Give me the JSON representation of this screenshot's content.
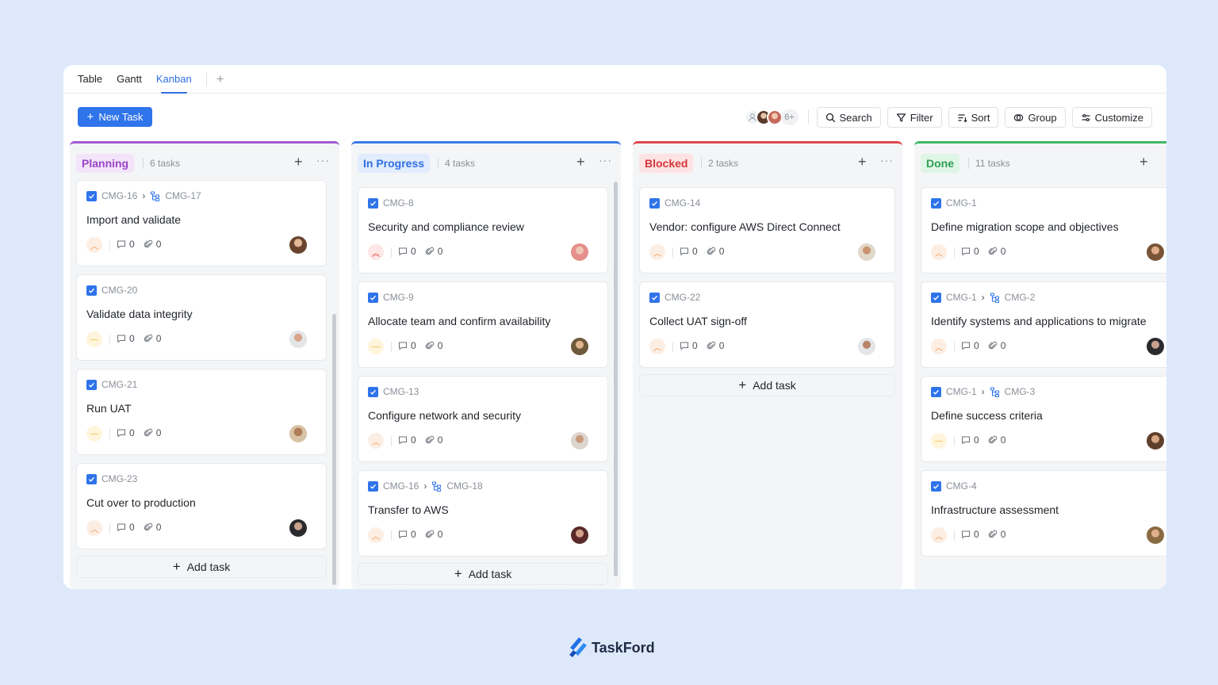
{
  "tabs": [
    {
      "label": "Table",
      "active": false
    },
    {
      "label": "Gantt",
      "active": false
    },
    {
      "label": "Kanban",
      "active": true
    }
  ],
  "toolbar": {
    "new_task_label": "New Task",
    "avatars_more": "6+",
    "search_label": "Search",
    "filter_label": "Filter",
    "sort_label": "Sort",
    "group_label": "Group",
    "customize_label": "Customize"
  },
  "colors": {
    "accent": "#2f74ea",
    "planning": "#a35bd0",
    "in_progress": "#3a7be6",
    "blocked": "#e0484d",
    "done": "#3fb964"
  },
  "columns": [
    {
      "title": "Planning",
      "count": "6 tasks",
      "add_label": "Add task",
      "cards": [
        {
          "id": "CMG-16",
          "sub_id": "CMG-17",
          "title": "Import and validate",
          "priority": "high",
          "comments": "0",
          "attachments": "0",
          "assignee": "avatar"
        },
        {
          "id": "CMG-20",
          "title": "Validate data integrity",
          "priority": "medium",
          "comments": "0",
          "attachments": "0",
          "assignee": "avatar"
        },
        {
          "id": "CMG-21",
          "title": "Run UAT",
          "priority": "medium",
          "comments": "0",
          "attachments": "0",
          "assignee": "avatar"
        },
        {
          "id": "CMG-23",
          "title": "Cut over to production",
          "priority": "high",
          "comments": "0",
          "attachments": "0",
          "assignee": "avatar"
        }
      ]
    },
    {
      "title": "In Progress",
      "count": "4 tasks",
      "add_label": "Add task",
      "cards": [
        {
          "id": "CMG-8",
          "title": "Security and compliance review",
          "priority": "urgent",
          "comments": "0",
          "attachments": "0",
          "assignee": "avatar"
        },
        {
          "id": "CMG-9",
          "title": "Allocate team and confirm availability",
          "priority": "medium",
          "comments": "0",
          "attachments": "0",
          "assignee": "avatar"
        },
        {
          "id": "CMG-13",
          "title": "Configure network and security",
          "priority": "high",
          "comments": "0",
          "attachments": "0",
          "assignee": "avatar"
        },
        {
          "id": "CMG-16",
          "sub_id": "CMG-18",
          "title": "Transfer to AWS",
          "priority": "high",
          "comments": "0",
          "attachments": "0",
          "assignee": "avatar"
        }
      ]
    },
    {
      "title": "Blocked",
      "count": "2 tasks",
      "add_label": "Add task",
      "cards": [
        {
          "id": "CMG-14",
          "title": "Vendor: configure AWS Direct Connect",
          "priority": "high",
          "comments": "0",
          "attachments": "0",
          "assignee": "avatar"
        },
        {
          "id": "CMG-22",
          "title": "Collect UAT sign-off",
          "priority": "high",
          "comments": "0",
          "attachments": "0",
          "assignee": "avatar"
        }
      ]
    },
    {
      "title": "Done",
      "count": "11 tasks",
      "cards": [
        {
          "id": "CMG-1",
          "title": "Define migration scope and objectives",
          "priority": "high",
          "comments": "0",
          "attachments": "0",
          "assignee": "avatar"
        },
        {
          "id": "CMG-1",
          "sub_id": "CMG-2",
          "title": "Identify systems and applications to migrate",
          "priority": "high",
          "comments": "0",
          "attachments": "0",
          "assignee": "avatar"
        },
        {
          "id": "CMG-1",
          "sub_id": "CMG-3",
          "title": "Define success criteria",
          "priority": "medium",
          "comments": "0",
          "attachments": "0",
          "assignee": "avatar"
        },
        {
          "id": "CMG-4",
          "title": "Infrastructure assessment",
          "priority": "high",
          "comments": "0",
          "attachments": "0",
          "assignee": "avatar"
        }
      ]
    }
  ],
  "brand": {
    "name": "TaskFord"
  }
}
